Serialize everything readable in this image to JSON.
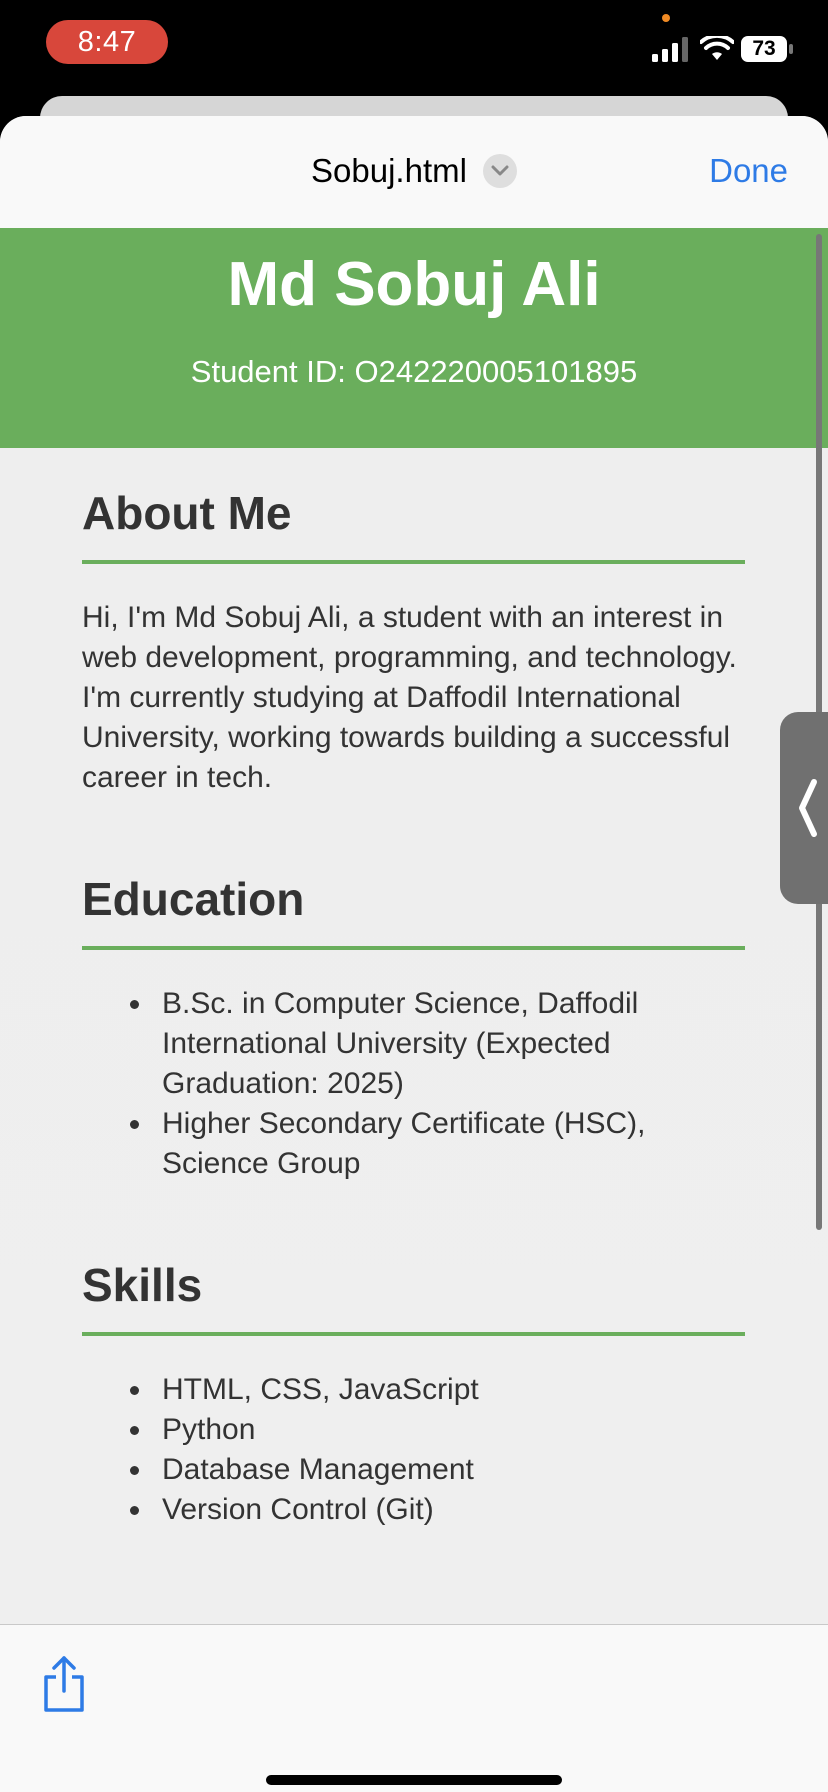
{
  "status_bar": {
    "time": "8:47",
    "battery": "73"
  },
  "nav": {
    "title": "Sobuj.html",
    "done_label": "Done"
  },
  "page": {
    "name": "Md Sobuj Ali",
    "student_id": "Student ID: O242220005101895",
    "about": {
      "heading": "About Me",
      "text": "Hi, I'm Md Sobuj Ali, a student with an interest in web development, programming, and technology. I'm currently studying at Daffodil International University, working towards building a successful career in tech."
    },
    "education": {
      "heading": "Education",
      "items": [
        "B.Sc. in Computer Science, Daffodil International University (Expected Graduation: 2025)",
        "Higher Secondary Certificate (HSC), Science Group"
      ]
    },
    "skills": {
      "heading": "Skills",
      "items": [
        "HTML, CSS, JavaScript",
        "Python",
        "Database Management",
        "Version Control (Git)"
      ]
    }
  },
  "icons": {
    "signal": "signal-icon",
    "wifi": "wifi-icon",
    "battery": "battery-icon",
    "dropdown": "chevron-down-icon",
    "handle": "chevron-left-icon",
    "share": "share-icon"
  },
  "colors": {
    "accent_green": "#6aae5c",
    "link_blue": "#2e7be6",
    "time_pill": "#d8473b"
  }
}
